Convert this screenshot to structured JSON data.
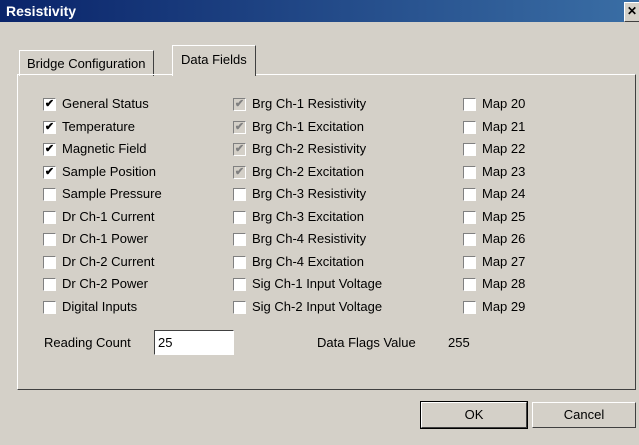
{
  "window": {
    "title": "Resistivity",
    "close_glyph": "✕"
  },
  "tabs": [
    {
      "label": "Bridge Configuration",
      "active": false
    },
    {
      "label": "Data Fields",
      "active": true
    }
  ],
  "checkboxes": {
    "col1": [
      {
        "label": "General Status",
        "checked": true,
        "disabled": false
      },
      {
        "label": "Temperature",
        "checked": true,
        "disabled": false
      },
      {
        "label": "Magnetic Field",
        "checked": true,
        "disabled": false
      },
      {
        "label": "Sample Position",
        "checked": true,
        "disabled": false
      },
      {
        "label": "Sample Pressure",
        "checked": false,
        "disabled": false
      },
      {
        "label": "Dr Ch-1 Current",
        "checked": false,
        "disabled": false
      },
      {
        "label": "Dr Ch-1 Power",
        "checked": false,
        "disabled": false
      },
      {
        "label": "Dr Ch-2 Current",
        "checked": false,
        "disabled": false
      },
      {
        "label": "Dr Ch-2 Power",
        "checked": false,
        "disabled": false
      },
      {
        "label": "Digital Inputs",
        "checked": false,
        "disabled": false
      }
    ],
    "col2": [
      {
        "label": "Brg Ch-1 Resistivity",
        "checked": true,
        "disabled": true
      },
      {
        "label": "Brg Ch-1 Excitation",
        "checked": true,
        "disabled": true
      },
      {
        "label": "Brg Ch-2 Resistivity",
        "checked": true,
        "disabled": true
      },
      {
        "label": "Brg Ch-2 Excitation",
        "checked": true,
        "disabled": true
      },
      {
        "label": "Brg Ch-3 Resistivity",
        "checked": false,
        "disabled": false
      },
      {
        "label": "Brg Ch-3 Excitation",
        "checked": false,
        "disabled": false
      },
      {
        "label": "Brg Ch-4 Resistivity",
        "checked": false,
        "disabled": false
      },
      {
        "label": "Brg Ch-4 Excitation",
        "checked": false,
        "disabled": false
      },
      {
        "label": "Sig Ch-1 Input Voltage",
        "checked": false,
        "disabled": false
      },
      {
        "label": "Sig Ch-2 Input Voltage",
        "checked": false,
        "disabled": false
      }
    ],
    "col3": [
      {
        "label": "Map 20",
        "checked": false,
        "disabled": false
      },
      {
        "label": "Map 21",
        "checked": false,
        "disabled": false
      },
      {
        "label": "Map 22",
        "checked": false,
        "disabled": false
      },
      {
        "label": "Map 23",
        "checked": false,
        "disabled": false
      },
      {
        "label": "Map 24",
        "checked": false,
        "disabled": false
      },
      {
        "label": "Map 25",
        "checked": false,
        "disabled": false
      },
      {
        "label": "Map 26",
        "checked": false,
        "disabled": false
      },
      {
        "label": "Map 27",
        "checked": false,
        "disabled": false
      },
      {
        "label": "Map 28",
        "checked": false,
        "disabled": false
      },
      {
        "label": "Map 29",
        "checked": false,
        "disabled": false
      }
    ]
  },
  "check_glyph": "✔",
  "reading_count": {
    "label": "Reading Count",
    "value": "25"
  },
  "data_flags": {
    "label": "Data Flags Value",
    "value": "255"
  },
  "buttons": {
    "ok": "OK",
    "cancel": "Cancel"
  }
}
